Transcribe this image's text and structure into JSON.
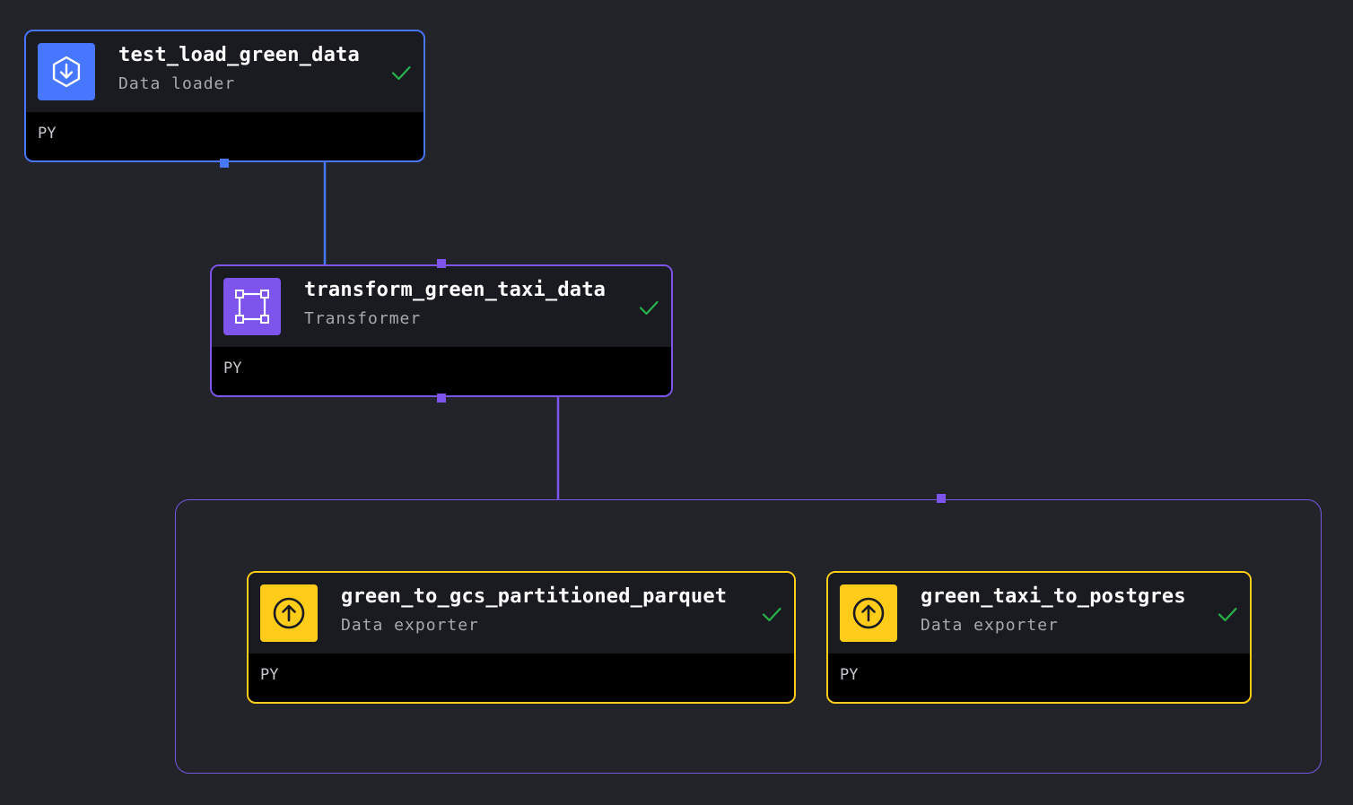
{
  "blocks": [
    {
      "name": "test_load_green_data",
      "type": "Data loader",
      "language": "PY",
      "status": "success",
      "color": "#4877ff",
      "icon": "download-icon"
    },
    {
      "name": "transform_green_taxi_data",
      "type": "Transformer",
      "language": "PY",
      "status": "success",
      "color": "#7d55ec",
      "icon": "transform-icon"
    },
    {
      "name": "green_to_gcs_partitioned_parquet",
      "type": "Data exporter",
      "language": "PY",
      "status": "success",
      "color": "#ffcc19",
      "icon": "upload-icon"
    },
    {
      "name": "green_taxi_to_postgres",
      "type": "Data exporter",
      "language": "PY",
      "status": "success",
      "color": "#ffcc19",
      "icon": "upload-icon"
    }
  ],
  "colors": {
    "background": "#232429",
    "loader": "#4877ff",
    "transformer": "#7d55ec",
    "exporter": "#ffcc19",
    "success": "#2ab24a"
  }
}
